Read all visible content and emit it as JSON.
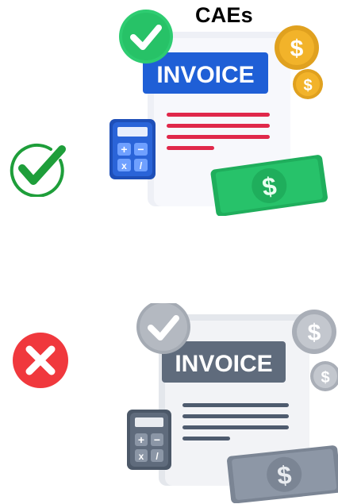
{
  "title": "CAEs",
  "items": [
    {
      "status_icon": "green-check-circle-icon",
      "invoice_label": "INVOICE",
      "style": "color",
      "colors": {
        "check_badge": "#2ecc71",
        "banner": "#1f5fd6",
        "lines": "#e0284a",
        "calculator": "#2a64d8",
        "bill": "#27c26a",
        "coin": "#f2b32a",
        "status": "#1e9e3a"
      }
    },
    {
      "status_icon": "red-x-circle-icon",
      "invoice_label": "INVOICE",
      "style": "grayscale",
      "colors": {
        "check_badge": "#a4aab3",
        "banner": "#5f6b7c",
        "lines": "#4e5b6e",
        "calculator": "#5f6b7c",
        "bill": "#8a94a3",
        "coin": "#b9bec6",
        "status": "#f0383d"
      }
    }
  ]
}
